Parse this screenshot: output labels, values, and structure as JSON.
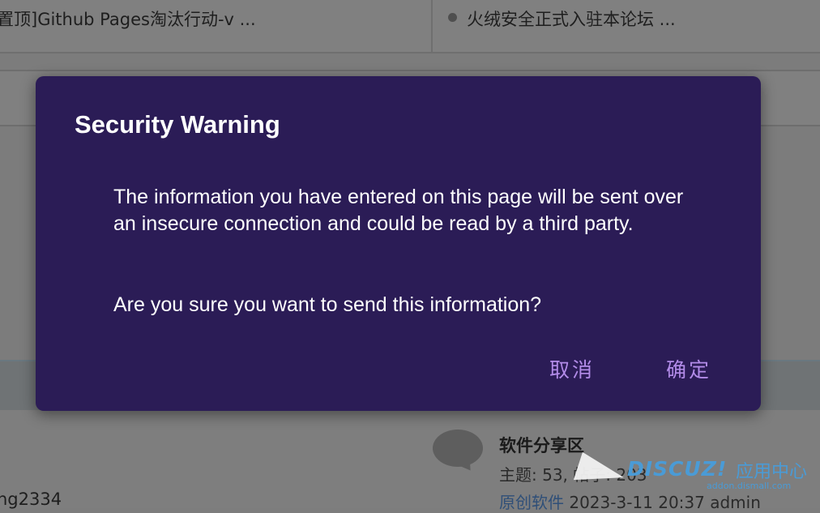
{
  "background": {
    "link_left": "置顶]Github Pages淘汰行动-v ...",
    "link_right": "火绒安全正式入驻本论坛 ...",
    "forum_title": "软件分享区",
    "forum_stats": "主题: 53, 帖子: 203",
    "forum_last_link": "原创软件",
    "forum_last_rest": " 2023-3-11 20:37 admin",
    "user_partial": "ng2334"
  },
  "watermark": {
    "brand": "DISCUZ!",
    "cn": "应用中心",
    "url": "addon.dismall.com"
  },
  "dialog": {
    "title": "Security Warning",
    "message": "The information you have entered on this page will be sent over an insecure connection and could be read by a third party.",
    "question": "Are you sure you want to send this information?",
    "cancel_label": "取消",
    "ok_label": "确定"
  },
  "colors": {
    "dialog_bg": "#2b1c56",
    "button_text": "#b28be8",
    "overlay": "#7c7c7c"
  }
}
